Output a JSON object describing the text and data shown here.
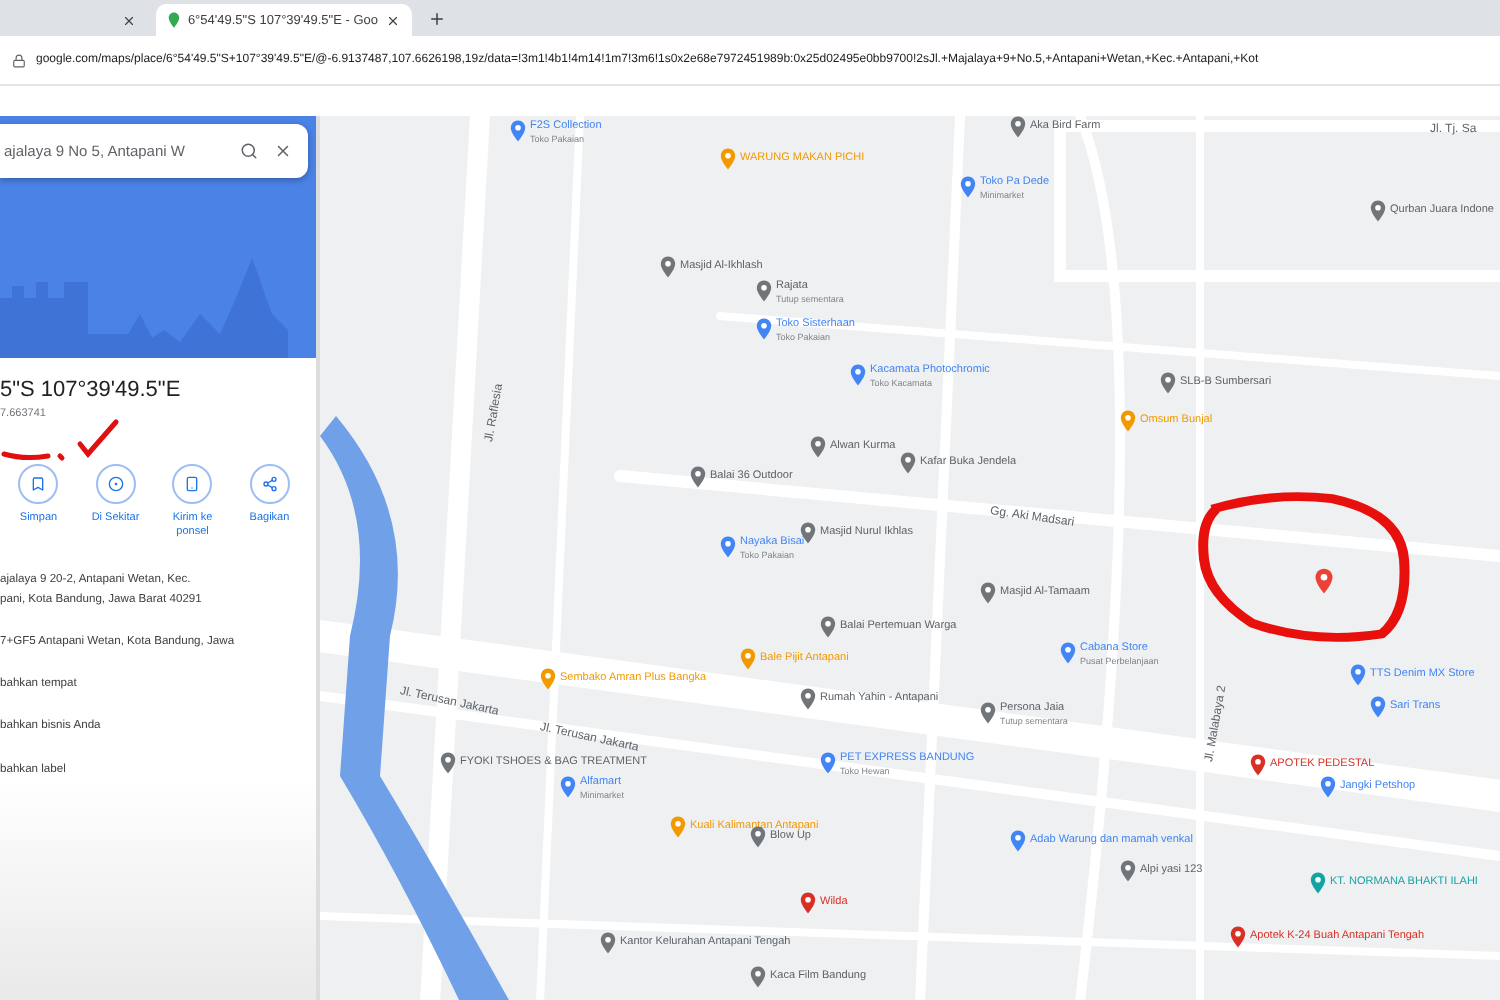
{
  "browser": {
    "tabs": [
      {
        "selected": false
      },
      {
        "title": "6°54'49.5\"S 107°39'49.5\"E - Goo",
        "selected": true
      }
    ],
    "url": "google.com/maps/place/6°54'49.5\"S+107°39'49.5\"E/@-6.9137487,107.6626198,19z/data=!3m1!4b1!4m14!1m7!3m6!1s0x2e68e7972451989b:0x25d02495e0bb9700!2sJl.+Majalaya+9+No.5,+Antapani+Wetan,+Kec.+Antapani,+Kot"
  },
  "panel": {
    "search": {
      "value": "ajalaya 9 No 5, Antapani W"
    },
    "coordinates": "5\"S 107°39'49.5\"E",
    "plus_code": "7.663741",
    "actions": [
      {
        "label": "Simpan",
        "kind": "save"
      },
      {
        "label": "Di Sekitar",
        "kind": "nearby"
      },
      {
        "label": "Kirim ke ponsel",
        "kind": "phone"
      },
      {
        "label": "Bagikan",
        "kind": "share"
      }
    ],
    "details": [
      {
        "lines": [
          "ajalaya 9 20-2, Antapani Wetan, Kec.",
          "pani, Kota Bandung, Jawa Barat 40291"
        ]
      },
      {
        "lines": [
          "7+GF5 Antapani Wetan, Kota Bandung, Jawa"
        ]
      },
      {
        "lines": [
          "bahkan tempat"
        ]
      },
      {
        "lines": [
          "bahkan bisnis Anda"
        ]
      },
      {
        "lines": [
          "bahkan label"
        ]
      }
    ]
  },
  "map": {
    "roads": [
      "Jl. Raflesia",
      "Jl. Terusan Jakarta",
      "Jl. Terusan Jakarta",
      "Gg. Aki Madsari",
      "Jl. Malabaya 2",
      "Jl. Tj. Sa"
    ],
    "places": [
      {
        "name": "F2S Collection",
        "sub": "Toko Pakaian",
        "color": "#4285f4"
      },
      {
        "name": "WARUNG MAKAN PICHI",
        "color": "#f29900"
      },
      {
        "name": "Aka Bird Farm",
        "color": "#70757a"
      },
      {
        "name": "Toko Pa Dede",
        "sub": "Minimarket",
        "color": "#4285f4"
      },
      {
        "name": "Masjid Al-Ikhlash",
        "color": "#70757a"
      },
      {
        "name": "Rajata",
        "sub": "Tutup sementara",
        "color": "#70757a"
      },
      {
        "name": "Toko Sisterhaan",
        "sub": "Toko Pakaian",
        "color": "#4285f4"
      },
      {
        "name": "Qurban Juara Indone",
        "color": "#70757a"
      },
      {
        "name": "Kacamata Photochromic",
        "sub": "Toko Kacamata",
        "color": "#4285f4"
      },
      {
        "name": "SLB-B Sumbersari",
        "color": "#70757a"
      },
      {
        "name": "Omsum Bunjal",
        "color": "#f29900"
      },
      {
        "name": "Alwan Kurma",
        "color": "#70757a"
      },
      {
        "name": "Kafar Buka Jendela",
        "color": "#70757a"
      },
      {
        "name": "Balai 36 Outdoor",
        "color": "#70757a"
      },
      {
        "name": "Masjid Nurul Ikhlas",
        "color": "#70757a"
      },
      {
        "name": "Nayaka Bisai",
        "sub": "Toko Pakaian",
        "color": "#4285f4"
      },
      {
        "name": "Masjid Al-Tamaam",
        "color": "#70757a"
      },
      {
        "name": "Balai Pertemuan Warga",
        "color": "#70757a"
      },
      {
        "name": "Sembako Amran Plus Bangka",
        "color": "#f29900"
      },
      {
        "name": "Bale Pijit Antapani",
        "color": "#f29900"
      },
      {
        "name": "Rumah Yahin - Antapani",
        "color": "#70757a"
      },
      {
        "name": "Cabana Store",
        "sub": "Pusat Perbelanjaan",
        "color": "#4285f4"
      },
      {
        "name": "TTS Denim MX Store",
        "color": "#4285f4"
      },
      {
        "name": "Persona Jaia",
        "sub": "Tutup sementara",
        "color": "#70757a"
      },
      {
        "name": "Sari Trans",
        "color": "#4285f4"
      },
      {
        "name": "FYOKI TSHOES & BAG TREATMENT",
        "color": "#70757a"
      },
      {
        "name": "PET EXPRESS BANDUNG",
        "sub": "Toko Hewan",
        "color": "#4285f4"
      },
      {
        "name": "Alfamart",
        "sub": "Minimarket",
        "color": "#4285f4"
      },
      {
        "name": "APOTEK PEDESTAL",
        "color": "#d93025"
      },
      {
        "name": "Jangki Petshop",
        "color": "#4285f4"
      },
      {
        "name": "Kuali Kalimantan Antapani",
        "color": "#f29900"
      },
      {
        "name": "Blow Up",
        "color": "#70757a"
      },
      {
        "name": "Adab Warung dan mamah venkal",
        "color": "#4285f4"
      },
      {
        "name": "Alpi yasi 123",
        "color": "#70757a"
      },
      {
        "name": "KT. NORMANA BHAKTI ILAHI",
        "color": "#12a4a4"
      },
      {
        "name": "Wilda",
        "color": "#d93025"
      },
      {
        "name": "Apotek K-24 Buah Antapani Tengah",
        "color": "#d93025"
      },
      {
        "name": "Kantor Kelurahan Antapani Tengah",
        "color": "#70757a"
      },
      {
        "name": "Kaca Film Bandung",
        "color": "#70757a"
      }
    ]
  }
}
